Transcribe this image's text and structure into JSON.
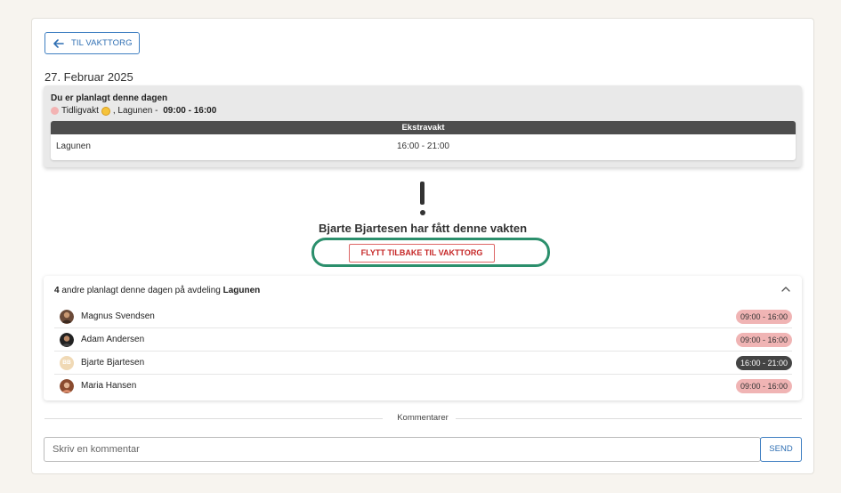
{
  "nav": {
    "back_label": "TIL VAKTTORG"
  },
  "date_title": "27. Februar 2025",
  "planned": {
    "title": "Du er planlagt denne dagen",
    "shift_name": "Tidligvakt",
    "shift_suffix": ", Lagunen - ",
    "shift_time": "09:00 - 16:00"
  },
  "extra_shift": {
    "header": "Ekstravakt",
    "location": "Lagunen",
    "time": "16:00 - 21:00"
  },
  "status": {
    "message": "Bjarte Bjartesen har fått denne vakten",
    "move_back_label": "FLYTT TILBAKE TIL VAKTTORG"
  },
  "others": {
    "count": "4",
    "text": " andre planlagt denne dagen på avdeling ",
    "department": "Lagunen",
    "people": [
      {
        "name": "Magnus Svendsen",
        "time": "09:00 - 16:00",
        "initials": ""
      },
      {
        "name": "Adam Andersen",
        "time": "09:00 - 16:00",
        "initials": ""
      },
      {
        "name": "Bjarte Bjartesen",
        "time": "16:00 - 21:00",
        "initials": "BB"
      },
      {
        "name": "Maria Hansen",
        "time": "09:00 - 16:00",
        "initials": ""
      }
    ]
  },
  "comments": {
    "label": "Kommentarer",
    "placeholder": "Skriv en kommentar",
    "send_label": "SEND"
  },
  "colors": {
    "accent_blue": "#2f6fb3",
    "highlight_green": "#2b8f6c",
    "shift_pink": "#f0b4b4",
    "shift_dark": "#444444",
    "alert_red": "#c62828"
  }
}
